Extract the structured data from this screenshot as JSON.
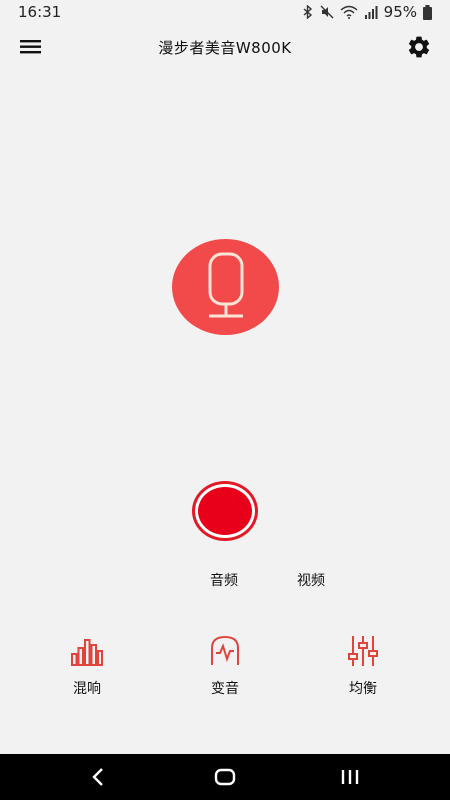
{
  "status_bar": {
    "time": "16:31",
    "battery_percent": "95%",
    "icons": [
      "bluetooth-icon",
      "mute-icon",
      "wifi-icon",
      "signal-icon",
      "battery-icon"
    ]
  },
  "app_bar": {
    "title": "漫步者美音W800K",
    "icons": [
      "menu-icon",
      "settings-gear-icon"
    ]
  },
  "main": {
    "mic_icon": "microphone-icon",
    "record_button_color": "#e8001a",
    "mic_bg_color": "#f24a4a"
  },
  "mode_switch": {
    "audio_label": "音频",
    "video_label": "视频"
  },
  "tools": [
    {
      "label": "混响",
      "icon": "bars-icon"
    },
    {
      "label": "变音",
      "icon": "voice-change-icon"
    },
    {
      "label": "均衡",
      "icon": "equalizer-icon"
    }
  ],
  "accent_color": "#e0453c",
  "nav_bar": {
    "icons": [
      "back-icon",
      "home-icon",
      "recents-icon"
    ]
  }
}
